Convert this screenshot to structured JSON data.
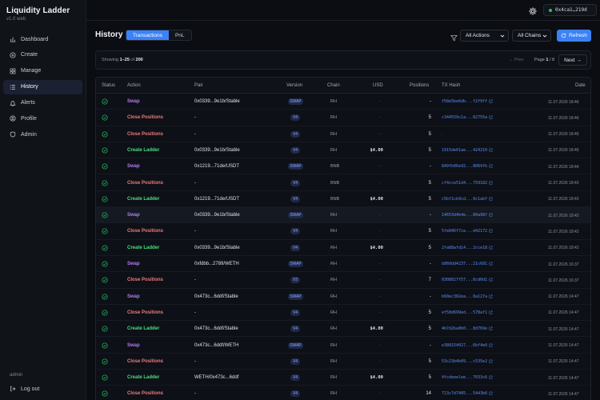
{
  "app": {
    "title": "Liquidity Ladder",
    "version": "v1.0 web"
  },
  "sidebar": {
    "items": [
      {
        "label": "Dashboard",
        "icon": "chart-bars-icon",
        "active": false
      },
      {
        "label": "Create",
        "icon": "plus-circle-icon",
        "active": false
      },
      {
        "label": "Manage",
        "icon": "sliders-icon",
        "active": false
      },
      {
        "label": "History",
        "icon": "list-icon",
        "active": true
      },
      {
        "label": "Alerts",
        "icon": "bell-icon",
        "active": false
      },
      {
        "label": "Profile",
        "icon": "user-circle-icon",
        "active": false
      },
      {
        "label": "Admin",
        "icon": "shield-icon",
        "active": false
      }
    ],
    "user": "admin",
    "logout_label": "Log out"
  },
  "topbar": {
    "wallet": "0x4ca1…219d",
    "wallet_status_color": "#22c55e"
  },
  "page": {
    "title": "History",
    "tabs": [
      {
        "label": "Transactions",
        "active": true
      },
      {
        "label": "PnL",
        "active": false
      }
    ],
    "action_filter": "All Actions",
    "chain_filter": "All Chains",
    "refresh_label": "Refresh"
  },
  "pagination": {
    "showing_prefix": "Showing",
    "range": "1–25",
    "of_label": "of",
    "total": "200",
    "prev_label": "← Prev",
    "page_label": "Page",
    "page": "1",
    "page_sep": "/",
    "pages": "8",
    "next_label": "Next →"
  },
  "table": {
    "headers": {
      "status": "Status",
      "action": "Action",
      "pair": "Pair",
      "version": "Version",
      "chain": "Chain",
      "usd": "USD",
      "positions": "Positions",
      "tx": "TX Hash",
      "date": "Date"
    },
    "rows": [
      {
        "action": "Swap",
        "pair": "0x0339...9e1b/Stable",
        "version": "SWAP",
        "chain": "RH",
        "usd": "-",
        "positions": "-",
        "tx": "f58e5be6db...f2f9ff",
        "date": "11.07.2026 18:46"
      },
      {
        "action": "Close Positions",
        "pair": "-",
        "version": "V4",
        "chain": "RH",
        "usd": "-",
        "positions": "5",
        "tx": "c344559c1a...82755a",
        "date": "11.07.2026 18:46"
      },
      {
        "action": "Close Positions",
        "pair": "-",
        "version": "V4",
        "chain": "RH",
        "usd": "-",
        "positions": "5",
        "tx": "-",
        "date": "11.07.2026 18:45"
      },
      {
        "action": "Create Ladder",
        "pair": "0x0339...9e1b/Stable",
        "version": "V4",
        "chain": "RH",
        "usd": "$4.00",
        "positions": "5",
        "tx": "1915de01ae...424210",
        "date": "11.07.2026 18:45"
      },
      {
        "action": "Swap",
        "pair": "0x1219...71de/USDT",
        "version": "SWAP",
        "chain": "BNB",
        "usd": "-",
        "positions": "-",
        "tx": "849fb06e92...8069fb",
        "date": "11.07.2026 18:44"
      },
      {
        "action": "Close Positions",
        "pair": "-",
        "version": "V4",
        "chain": "BNB",
        "usd": "-",
        "positions": "5",
        "tx": "cf4cce51d4...759182",
        "date": "11.07.2026 18:43"
      },
      {
        "action": "Create Ladder",
        "pair": "0x1219...71de/USDT",
        "version": "V4",
        "chain": "BNB",
        "usd": "$4.00",
        "positions": "5",
        "tx": "c5bf1cb9cd...9c1abf",
        "date": "11.07.2026 18:43"
      },
      {
        "action": "Swap",
        "pair": "0x0339...9e1b/Stable",
        "version": "SWAP",
        "chain": "RH",
        "usd": "-",
        "positions": "-",
        "tx": "14653d4b4e...80a98f",
        "date": "11.07.2026 18:42"
      },
      {
        "action": "Close Positions",
        "pair": "-",
        "version": "V4",
        "chain": "RH",
        "usd": "-",
        "positions": "5",
        "tx": "5fe846f7ce...d42172",
        "date": "11.07.2026 18:42"
      },
      {
        "action": "Create Ladder",
        "pair": "0x0339...9e1b/Stable",
        "version": "V4",
        "chain": "RH",
        "usd": "$4.00",
        "positions": "5",
        "tx": "2fa88afd14...2cce18",
        "date": "11.07.2026 18:42"
      },
      {
        "action": "Swap",
        "pair": "0xfdbb...2789/WETH",
        "version": "SWAP",
        "chain": "RH",
        "usd": "-",
        "positions": "-",
        "tx": "b860dd4237...21c681",
        "date": "11.07.2026 16:37"
      },
      {
        "action": "Close Positions",
        "pair": "-",
        "version": "V3",
        "chain": "RH",
        "usd": "-",
        "positions": "7",
        "tx": "0308027f57...8cd0d1",
        "date": "11.07.2026 16:37"
      },
      {
        "action": "Swap",
        "pair": "0x473c...6ddf/Stable",
        "version": "SWAP",
        "chain": "RH",
        "usd": "-",
        "positions": "-",
        "tx": "b60ec382ea...8a127a",
        "date": "11.07.2026 14:47"
      },
      {
        "action": "Close Positions",
        "pair": "-",
        "version": "V4",
        "chain": "RH",
        "usd": "-",
        "positions": "5",
        "tx": "ef58d699ed...578af1",
        "date": "11.07.2026 14:47"
      },
      {
        "action": "Create Ladder",
        "pair": "0x473c...6ddf/Stable",
        "version": "V4",
        "chain": "RH",
        "usd": "$4.00",
        "positions": "5",
        "tx": "4b7d2ba0b0...8d769e",
        "date": "11.07.2026 14:47"
      },
      {
        "action": "Swap",
        "pair": "0x473c...6ddf/WETH",
        "version": "SWAP",
        "chain": "RH",
        "usd": "-",
        "positions": "-",
        "tx": "e380154027...6bf4e0",
        "date": "11.07.2026 14:47"
      },
      {
        "action": "Close Positions",
        "pair": "-",
        "version": "V4",
        "chain": "RH",
        "usd": "-",
        "positions": "5",
        "tx": "53c23b4b09...c535e2",
        "date": "11.07.2026 14:47"
      },
      {
        "action": "Create Ladder",
        "pair": "WETH/0x473c...6ddf",
        "version": "V4",
        "chain": "RH",
        "usd": "$4.00",
        "positions": "5",
        "tx": "4fcdeeelee...7033c6",
        "date": "11.07.2026 14:47"
      },
      {
        "action": "Close Positions",
        "pair": "-",
        "version": "V4",
        "chain": "RH",
        "usd": "-",
        "positions": "14",
        "tx": "713c7d7405...5443b6",
        "date": "11.07.2026 14:47"
      }
    ]
  },
  "colors": {
    "swap": "#b77cf5",
    "close": "#f07a7a",
    "create": "#4ade80",
    "status_ok": "#22c55e",
    "accent": "#3b82f6"
  }
}
